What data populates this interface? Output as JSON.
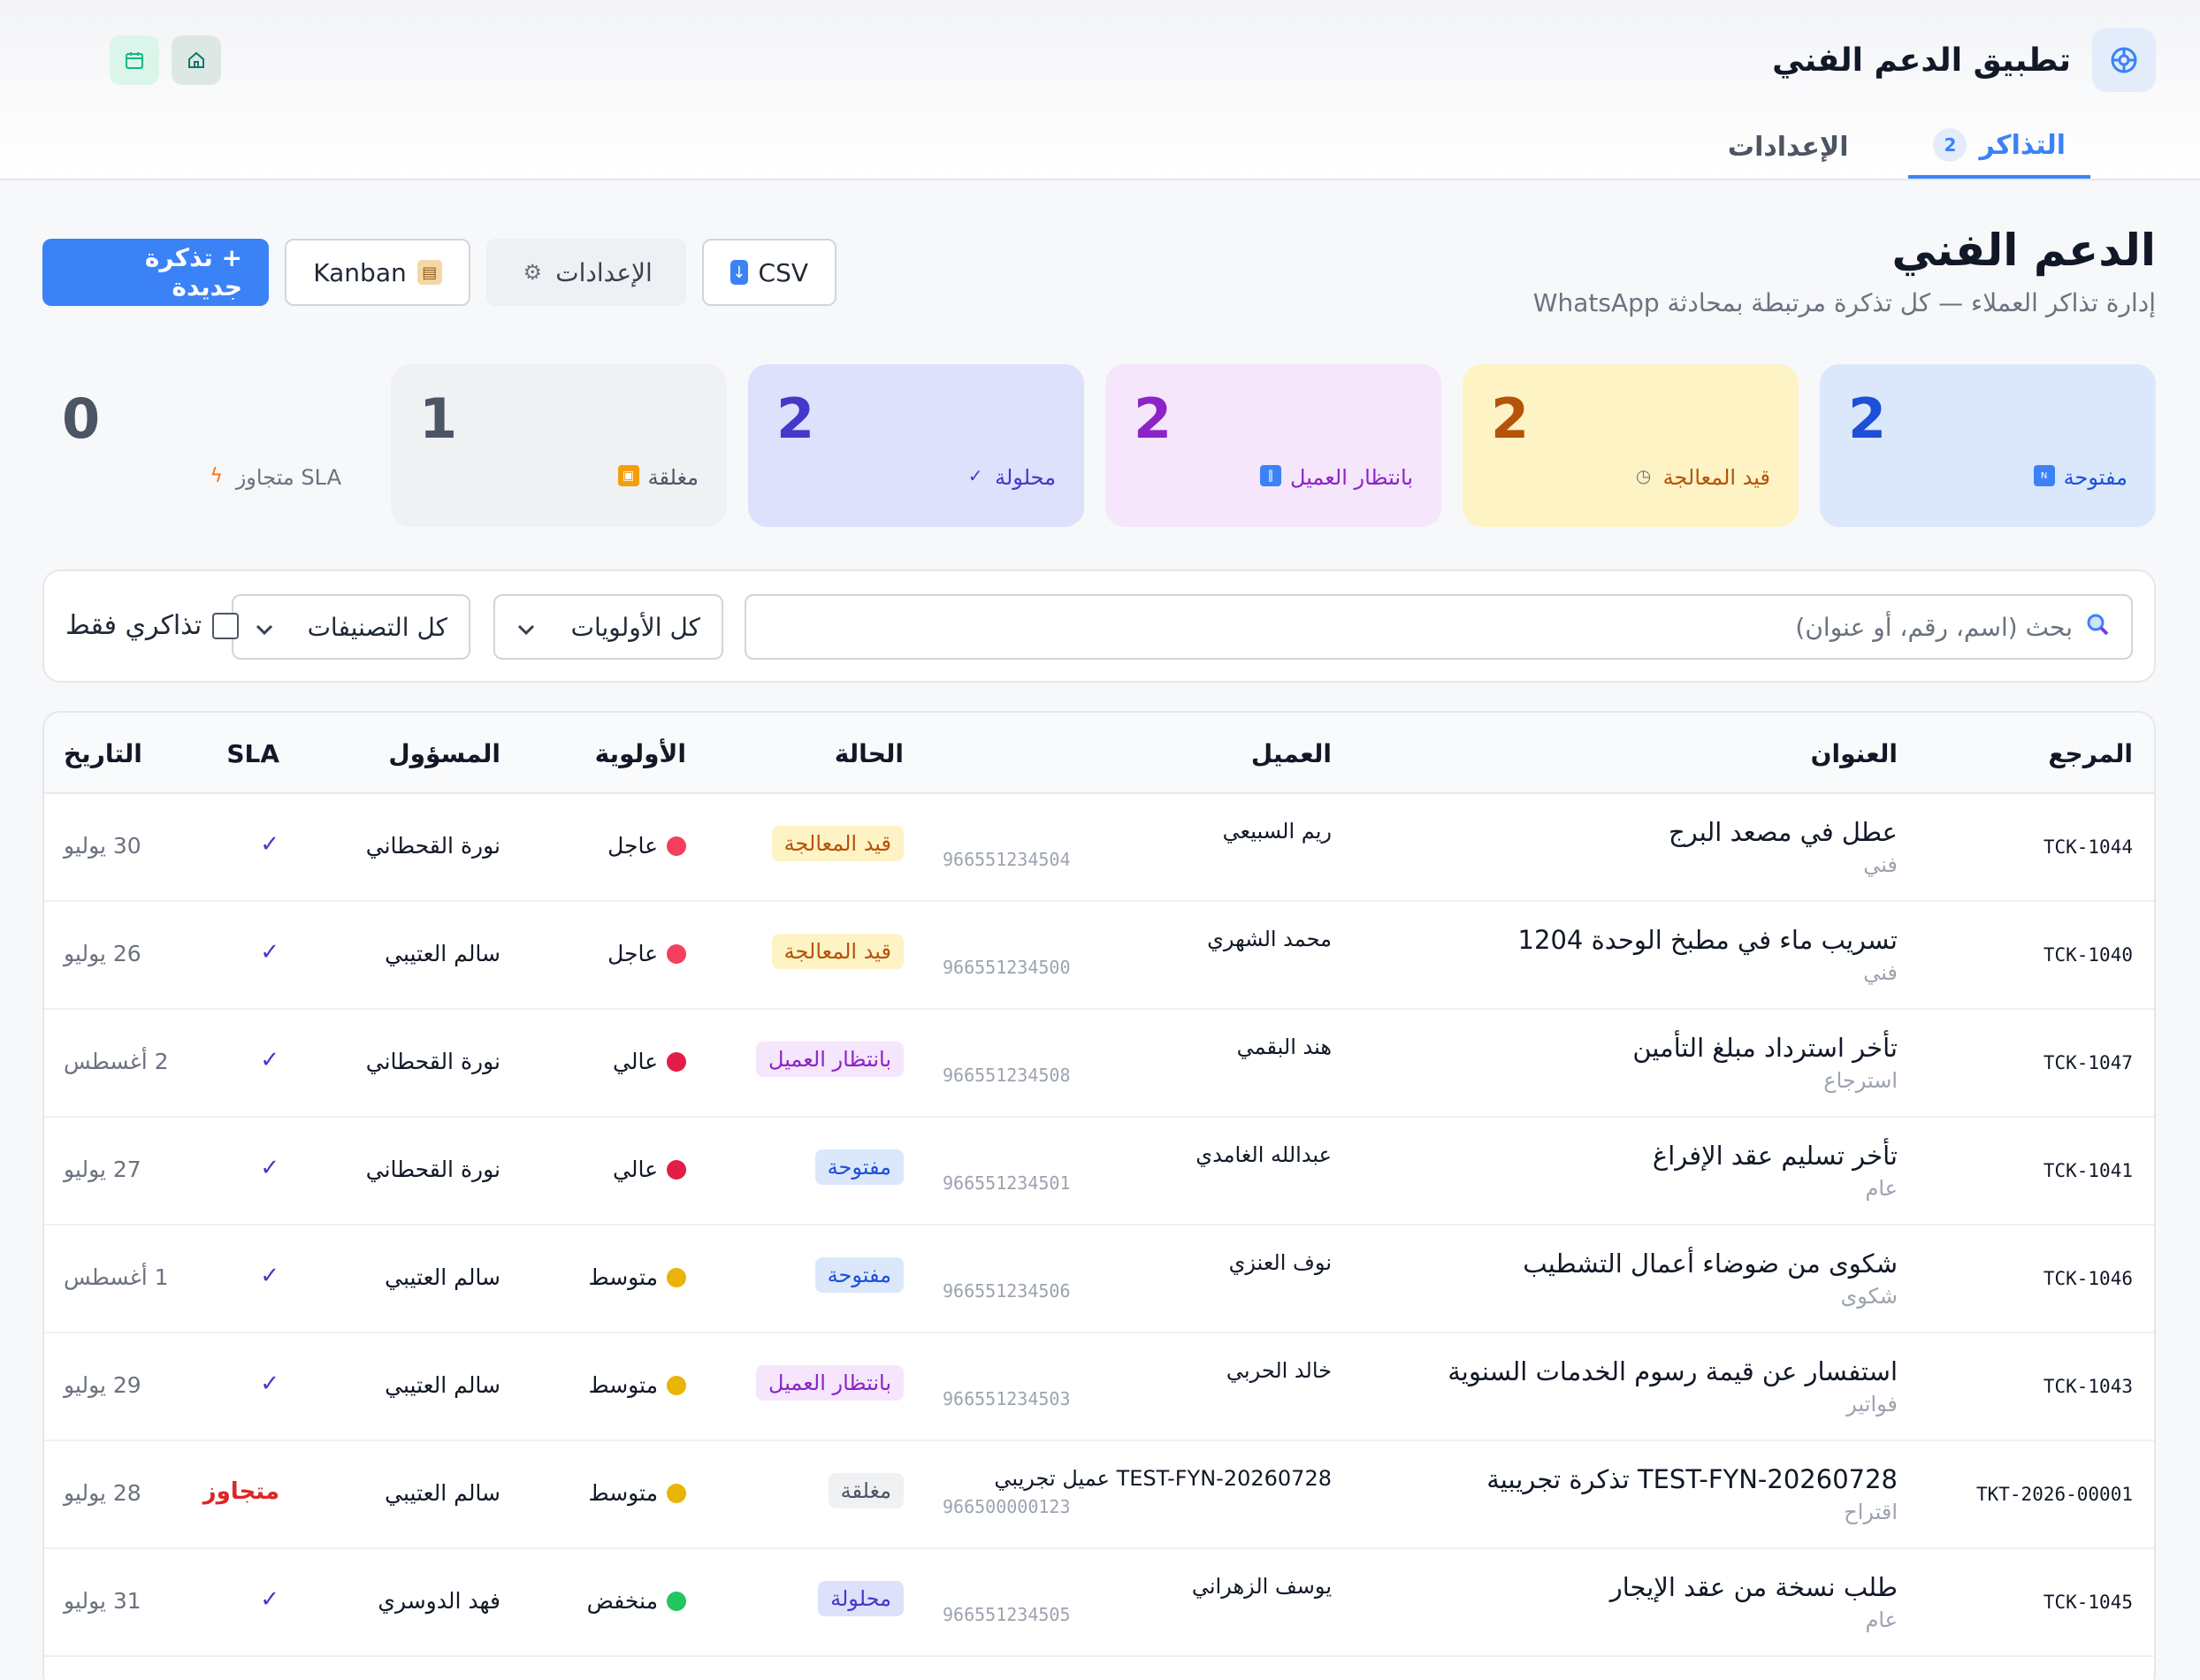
{
  "app": {
    "title": "تطبيق الدعم الفني"
  },
  "tabs": [
    {
      "label": "التذاكر",
      "badge": "2"
    },
    {
      "label": "الإعدادات"
    }
  ],
  "page": {
    "title": "الدعم الفني",
    "subtitle": "إدارة تذاكر العملاء — كل تذكرة مرتبطة بمحادثة WhatsApp"
  },
  "actions": {
    "new_ticket": "+ تذكرة جديدة",
    "kanban": "Kanban",
    "settings": "الإعدادات",
    "csv": "CSV"
  },
  "stats": [
    {
      "value": "2",
      "label": "مفتوحة",
      "icon": "new-icon"
    },
    {
      "value": "2",
      "label": "قيد المعالجة",
      "icon": "stopwatch-icon"
    },
    {
      "value": "2",
      "label": "بانتظار العميل",
      "icon": "pause-icon"
    },
    {
      "value": "2",
      "label": "محلولة",
      "icon": "check-icon"
    },
    {
      "value": "1",
      "label": "مغلقة",
      "icon": "lock-icon"
    },
    {
      "value": "0",
      "label": "SLA متجاوز",
      "icon": "lightning-icon"
    }
  ],
  "filters": {
    "search_placeholder": "بحث (اسم، رقم، أو عنوان)",
    "priority": "كل الأولويات",
    "category": "كل التصنيفات",
    "mine": "تذاكري فقط"
  },
  "table": {
    "headers": {
      "ref": "المرجع",
      "title": "العنوان",
      "customer": "العميل",
      "status": "الحالة",
      "priority": "الأولوية",
      "owner": "المسؤول",
      "sla": "SLA",
      "date": "التاريخ"
    },
    "rows": [
      {
        "ref": "TCK-1044",
        "title": "عطل في مصعد البرج",
        "category": "فني",
        "customer": "ريم السبيعي",
        "phone": "966551234504",
        "status": "قيد المعالجة",
        "status_kind": "proc",
        "priority": "عاجل",
        "owner": "نورة القحطاني",
        "sla": "✓",
        "date": "30 يوليو"
      },
      {
        "ref": "TCK-1040",
        "title": "تسريب ماء في مطبخ الوحدة 1204",
        "category": "فني",
        "customer": "محمد الشهري",
        "phone": "966551234500",
        "status": "قيد المعالجة",
        "status_kind": "proc",
        "priority": "عاجل",
        "owner": "سالم العتيبي",
        "sla": "✓",
        "date": "26 يوليو"
      },
      {
        "ref": "TCK-1047",
        "title": "تأخر استرداد مبلغ التأمين",
        "category": "استرجاع",
        "customer": "هند البقمي",
        "phone": "966551234508",
        "status": "بانتظار العميل",
        "status_kind": "wait",
        "priority": "عالي",
        "owner": "نورة القحطاني",
        "sla": "✓",
        "date": "2 أغسطس"
      },
      {
        "ref": "TCK-1041",
        "title": "تأخر تسليم عقد الإفراغ",
        "category": "عام",
        "customer": "عبدالله الغامدي",
        "phone": "966551234501",
        "status": "مفتوحة",
        "status_kind": "open",
        "priority": "عالي",
        "owner": "نورة القحطاني",
        "sla": "✓",
        "date": "27 يوليو"
      },
      {
        "ref": "TCK-1046",
        "title": "شكوى من ضوضاء أعمال التشطيب",
        "category": "شكوى",
        "customer": "نوف العنزي",
        "phone": "966551234506",
        "status": "مفتوحة",
        "status_kind": "open",
        "priority": "متوسط",
        "owner": "سالم العتيبي",
        "sla": "✓",
        "date": "1 أغسطس"
      },
      {
        "ref": "TCK-1043",
        "title": "استفسار عن قيمة رسوم الخدمات السنوية",
        "category": "فواتير",
        "customer": "خالد الحربي",
        "phone": "966551234503",
        "status": "بانتظار العميل",
        "status_kind": "wait",
        "priority": "متوسط",
        "owner": "سالم العتيبي",
        "sla": "✓",
        "date": "29 يوليو"
      },
      {
        "ref": "TKT-2026-00001",
        "title": "TEST-FYN-20260728 تذكرة تجريبية",
        "category": "اقتراح",
        "customer": "TEST-FYN-20260728 عميل تجريبي",
        "phone": "966500000123",
        "status": "مغلقة",
        "status_kind": "closed",
        "priority": "متوسط",
        "owner": "سالم العتيبي",
        "sla": "متجاوز",
        "date": "28 يوليو"
      },
      {
        "ref": "TCK-1045",
        "title": "طلب نسخة من عقد الإيجار",
        "category": "عام",
        "customer": "يوسف الزهراني",
        "phone": "966551234505",
        "status": "محلولة",
        "status_kind": "res",
        "priority": "منخفض",
        "owner": "فهد الدوسري",
        "sla": "✓",
        "date": "31 يوليو"
      }
    ]
  },
  "colors": {
    "accent": "#3b82f6",
    "urgent": "#f43f5e",
    "high": "#e11d48",
    "medium": "#eab308",
    "low": "#22c55e"
  }
}
